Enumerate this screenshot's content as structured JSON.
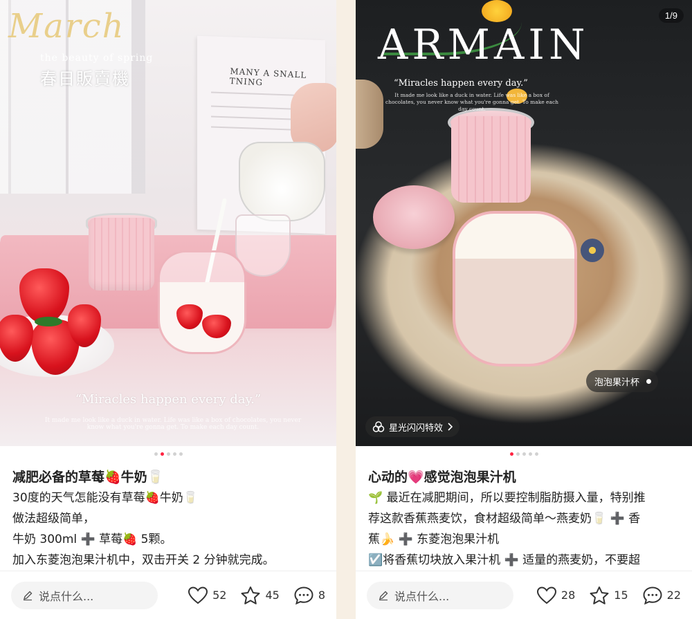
{
  "left_post": {
    "overlay": {
      "script_title": "March",
      "subtitle_en": "the beauty of spring",
      "subtitle_zh": "春日販賣機",
      "paper_title": "MANY A SNALL TNING",
      "quote": "“Miracles happen every day.”",
      "quote_small": "It made me look like a duck in water. Life was like a box of chocolates, you never know what you're gonna get. To make each day count."
    },
    "dots": [
      false,
      true,
      false,
      false,
      false
    ],
    "title": "减肥必备的草莓🍓牛奶🥛",
    "lines": [
      "30度的天气怎能没有草莓🍓牛奶🥛",
      "做法超级简单，",
      "牛奶 300ml ➕ 草莓🍓 5颗。",
      "加入东菱泡泡果汁机中，双击开关 2 分钟就完成。"
    ],
    "comment_placeholder": "说点什么...",
    "likes": "52",
    "collects": "45",
    "comments": "8"
  },
  "right_post": {
    "overlay": {
      "brand": "ARMAIN",
      "quote": "“Miracles happen every day.”",
      "quote_small": "It made me look like a duck in water. Life was like a box of chocolates, you never know what you're gonna get. To make each day count."
    },
    "counter": "1/9",
    "product_tag": "泡泡果汁杯",
    "effect_label": "星光闪闪特效",
    "dots": [
      true,
      false,
      false,
      false,
      false
    ],
    "title": "心动的💗感觉泡泡果汁机",
    "lines": [
      "🌱 最近在减肥期间，所以要控制脂肪摄入量，特别推",
      "荐这款香蕉燕麦饮，食材超级简单～燕麦奶🥛 ➕ 香",
      "蕉🍌 ➕ 东菱泡泡果汁机",
      "☑️将香蕉切块放入果汁机 ➕ 适量的燕麦奶，不要超"
    ],
    "comment_placeholder": "说点什么...",
    "likes": "28",
    "collects": "15",
    "comments": "22"
  },
  "colors": {
    "accent": "#ff2442",
    "tray_pink": "#eba3ae",
    "text": "#222222"
  },
  "icons": [
    "pencil-icon",
    "heart-icon",
    "star-icon",
    "comment-icon",
    "effect-icon",
    "chevron-right-icon"
  ]
}
